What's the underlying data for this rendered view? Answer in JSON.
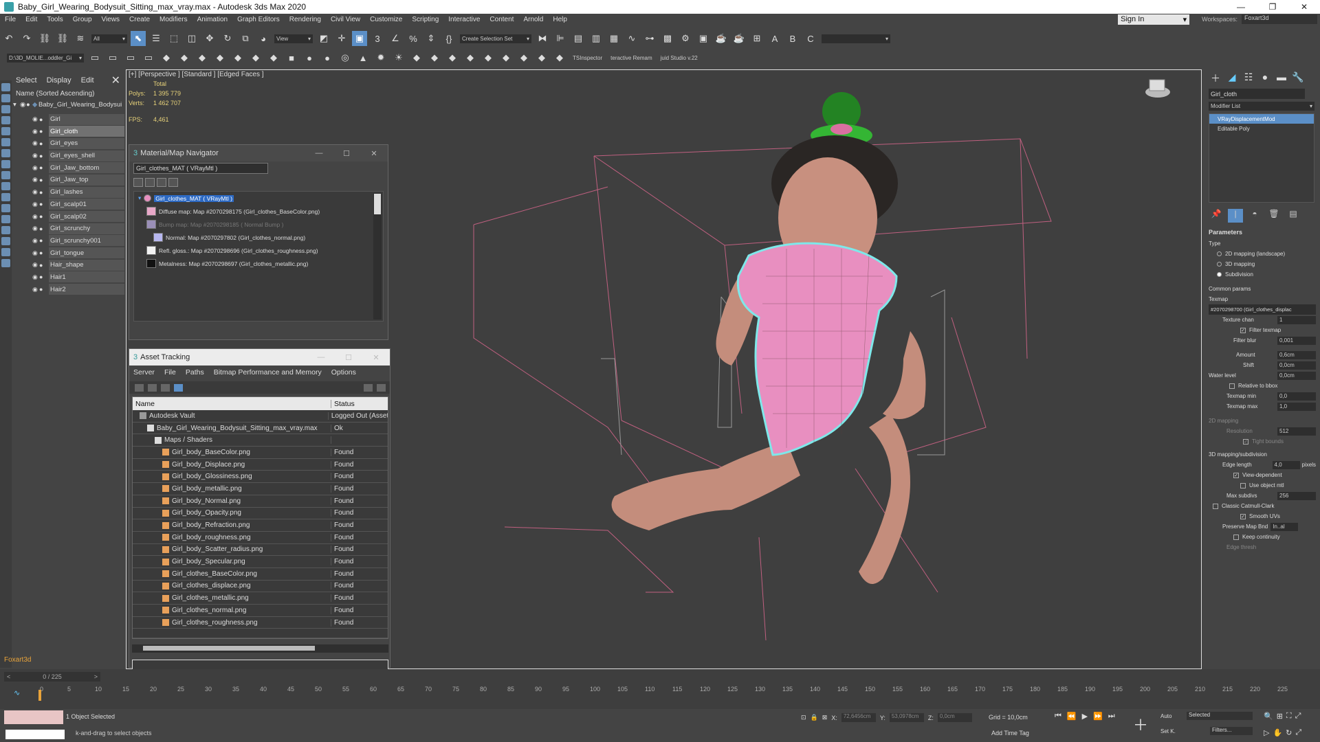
{
  "window": {
    "title": "Baby_Girl_Wearing_Bodysuit_Sitting_max_vray.max - Autodesk 3ds Max 2020"
  },
  "menu": [
    "File",
    "Edit",
    "Tools",
    "Group",
    "Views",
    "Create",
    "Modifiers",
    "Animation",
    "Graph Editors",
    "Rendering",
    "Civil View",
    "Customize",
    "Scripting",
    "Interactive",
    "Content",
    "Arnold",
    "Help"
  ],
  "signin": {
    "label": "Sign In",
    "workspaces_label": "Workspaces:",
    "workspace": "Foxart3d"
  },
  "toolbar1": {
    "filter": "All",
    "view": "View",
    "selection_set": "Create Selection Set"
  },
  "toolbar2": {
    "path": "D:\\3D_MOLIE...oddler_Gi",
    "items": [
      "TSInspector",
      "teractive Remam",
      "juid Studio v.22"
    ]
  },
  "scene_explorer": {
    "tabs": [
      "Select",
      "Display",
      "Edit"
    ],
    "header": "Name (Sorted Ascending)",
    "root": "Baby_Girl_Wearing_Bodysui",
    "items": [
      "Girl",
      "Girl_cloth",
      "Girl_eyes",
      "Girl_eyes_shell",
      "Girl_Jaw_bottom",
      "Girl_Jaw_top",
      "Girl_lashes",
      "Girl_scalp01",
      "Girl_scalp02",
      "Girl_scrunchy",
      "Girl_scrunchy001",
      "Girl_tongue",
      "Hair_shape",
      "Hair1",
      "Hair2"
    ],
    "selected": "Girl_cloth"
  },
  "viewport": {
    "label": "[+] [Perspective ] [Standard ] [Edged Faces ]",
    "total": "Total",
    "polys_label": "Polys:",
    "polys": "1 395 779",
    "verts_label": "Verts:",
    "verts": "1 462 707",
    "fps_label": "FPS:",
    "fps": "4,461"
  },
  "material_navigator": {
    "title": "Material/Map Navigator",
    "field": "Girl_clothes_MAT  ( VRayMtl )",
    "root": "Girl_clothes_MAT  ( VRayMtl )",
    "maps": [
      {
        "text": "Diffuse map: Map #2070298175 (Girl_clothes_BaseColor.png)",
        "color": "#e8a8c8"
      },
      {
        "text": "Bump map: Map #2070298185  ( Normal Bump )",
        "color": "#9a8fb8"
      },
      {
        "text": "Normal: Map #2070297802 (Girl_clothes_normal.png)",
        "color": "#b8b8f0"
      },
      {
        "text": "Refl. gloss.: Map #2070298696 (Girl_clothes_roughness.png)",
        "color": "#f2f2f2"
      },
      {
        "text": "Metalness: Map #2070298697 (Girl_clothes_metallic.png)",
        "color": "#111111"
      }
    ]
  },
  "asset_tracking": {
    "title": "Asset Tracking",
    "menu": [
      "Server",
      "File",
      "Paths",
      "Bitmap Performance and Memory",
      "Options"
    ],
    "columns": [
      "Name",
      "Status"
    ],
    "rows": [
      {
        "name": "Autodesk Vault",
        "status": "Logged Out (Asset",
        "indent": 0
      },
      {
        "name": "Baby_Girl_Wearing_Bodysuit_Sitting_max_vray.max",
        "status": "Ok",
        "indent": 1
      },
      {
        "name": "Maps / Shaders",
        "status": "",
        "indent": 2
      },
      {
        "name": "Girl_body_BaseColor.png",
        "status": "Found",
        "indent": 3
      },
      {
        "name": "Girl_body_Displace.png",
        "status": "Found",
        "indent": 3
      },
      {
        "name": "Girl_body_Glossiness.png",
        "status": "Found",
        "indent": 3
      },
      {
        "name": "Girl_body_metallic.png",
        "status": "Found",
        "indent": 3
      },
      {
        "name": "Girl_body_Normal.png",
        "status": "Found",
        "indent": 3
      },
      {
        "name": "Girl_body_Opacity.png",
        "status": "Found",
        "indent": 3
      },
      {
        "name": "Girl_body_Refraction.png",
        "status": "Found",
        "indent": 3
      },
      {
        "name": "Girl_body_roughness.png",
        "status": "Found",
        "indent": 3
      },
      {
        "name": "Girl_body_Scatter_radius.png",
        "status": "Found",
        "indent": 3
      },
      {
        "name": "Girl_body_Specular.png",
        "status": "Found",
        "indent": 3
      },
      {
        "name": "Girl_clothes_BaseColor.png",
        "status": "Found",
        "indent": 3
      },
      {
        "name": "Girl_clothes_displace.png",
        "status": "Found",
        "indent": 3
      },
      {
        "name": "Girl_clothes_metallic.png",
        "status": "Found",
        "indent": 3
      },
      {
        "name": "Girl_clothes_normal.png",
        "status": "Found",
        "indent": 3
      },
      {
        "name": "Girl_clothes_roughness.png",
        "status": "Found",
        "indent": 3
      }
    ]
  },
  "command_panel": {
    "object_name": "Girl_cloth",
    "modifier_list": "Modifier List",
    "stack": [
      "VRayDisplacementMod",
      "Editable Poly"
    ],
    "params": {
      "title": "Parameters",
      "type_label": "Type",
      "types": [
        "2D mapping (landscape)",
        "3D mapping",
        "Subdivision"
      ],
      "common_label": "Common params",
      "texmap_label": "Texmap",
      "texmap": "#2070298700 (Girl_clothes_displac",
      "texture_chan_label": "Texture chan",
      "texture_chan": "1",
      "filter_texmap": "Filter texmap",
      "filter_blur_label": "Filter blur",
      "filter_blur": "0,001",
      "amount_label": "Amount",
      "amount": "0,6cm",
      "shift_label": "Shift",
      "shift": "0,0cm",
      "water_label": "Water level",
      "water": "0,0cm",
      "relative": "Relative to bbox",
      "texmap_min_label": "Texmap min",
      "texmap_min": "0,0",
      "texmap_max_label": "Texmap max",
      "texmap_max": "1,0",
      "mapping2d": "2D mapping",
      "resolution_label": "Resolution",
      "resolution": "512",
      "tight": "Tight bounds",
      "mapping3d": "3D mapping/subdivision",
      "edge_label": "Edge length",
      "edge": "4,0",
      "edge_unit": "pixels",
      "view_dep": "View-dependent",
      "use_obj": "Use object mtl",
      "max_subdivs_label": "Max subdivs",
      "max_subdivs": "256",
      "catmull": "Classic Catmull-Clark",
      "smooth_uv": "Smooth UVs",
      "preserve_label": "Preserve Map Bnd",
      "preserve": "In..al",
      "keep": "Keep continuity",
      "edge_thresh": "Edge thresh"
    }
  },
  "timeline": {
    "frame": "0 / 225",
    "ticks": [
      "0",
      "5",
      "10",
      "15",
      "20",
      "25",
      "30",
      "35",
      "40",
      "45",
      "50",
      "55",
      "60",
      "65",
      "70",
      "75",
      "80",
      "85",
      "90",
      "95",
      "100",
      "105",
      "110",
      "115",
      "120",
      "125",
      "130",
      "135",
      "140",
      "145",
      "150",
      "155",
      "160",
      "165",
      "170",
      "175",
      "180",
      "185",
      "190",
      "195",
      "200",
      "205",
      "210",
      "215",
      "220",
      "225"
    ]
  },
  "status": {
    "user": "Foxart3d",
    "selection": "1 Object Selected",
    "hint": "k-and-drag to select objects",
    "x_label": "X:",
    "x": "72,6456cm",
    "y_label": "Y:",
    "y": "53,0978cm",
    "z_label": "Z:",
    "z": "0,0cm",
    "grid": "Grid = 10,0cm",
    "add_time_tag": "Add Time Tag",
    "auto": "Auto",
    "selected": "Selected",
    "setk": "Set K.",
    "filters": "Filters..."
  },
  "colors": {
    "accent": "#5b8fc7",
    "cloth": "#e88fc0",
    "skin": "#d49a86",
    "selection_outline": "#7ee8ea",
    "hair_green": "#2fb52f"
  }
}
